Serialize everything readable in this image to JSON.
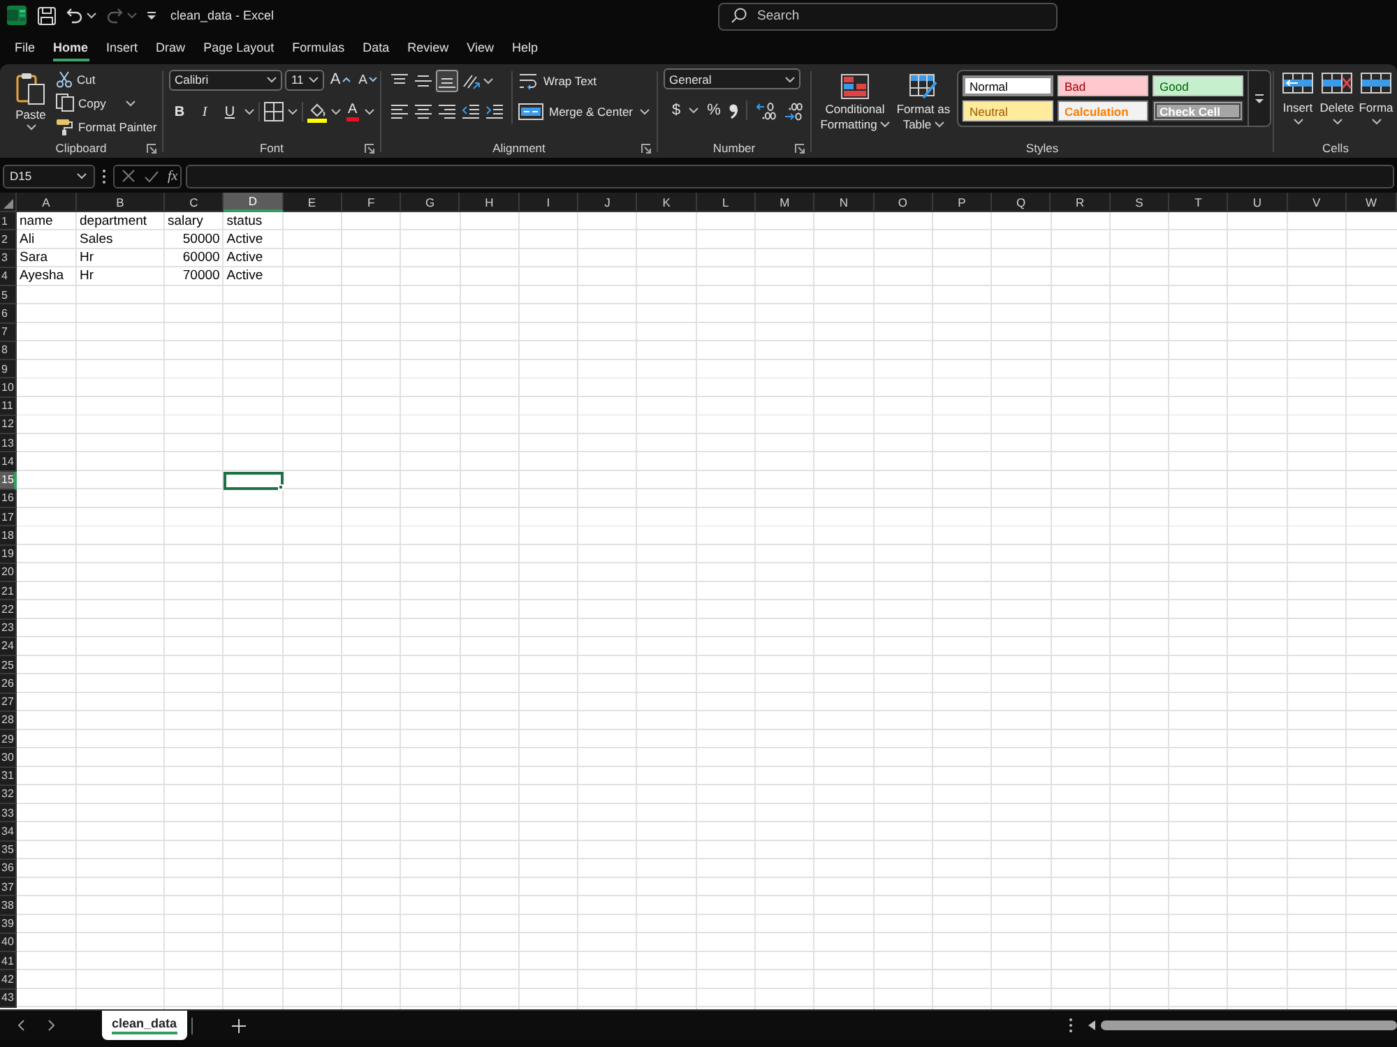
{
  "title_bar": {
    "quick_access": [
      {
        "kind": "save",
        "disabled": false
      },
      {
        "kind": "undo",
        "disabled": false
      },
      {
        "kind": "redo",
        "disabled": true
      }
    ],
    "title": "clean_data - Excel",
    "search": {
      "placeholder": "Search"
    }
  },
  "ribbon_tabs": [
    {
      "label": "File",
      "selected": false
    },
    {
      "label": "Home",
      "selected": true
    },
    {
      "label": "Insert",
      "selected": false
    },
    {
      "label": "Draw",
      "selected": false
    },
    {
      "label": "Page Layout",
      "selected": false
    },
    {
      "label": "Formulas",
      "selected": false
    },
    {
      "label": "Data",
      "selected": false
    },
    {
      "label": "Review",
      "selected": false
    },
    {
      "label": "View",
      "selected": false
    },
    {
      "label": "Help",
      "selected": false
    }
  ],
  "ribbon": {
    "clipboard": {
      "label": "Clipboard",
      "paste": "Paste",
      "cut": "Cut",
      "copy": "Copy",
      "format_painter": "Format Painter"
    },
    "font": {
      "label": "Font",
      "font_name": "Calibri",
      "font_size": "11",
      "grow": "A",
      "shrink": "A",
      "styles": [
        {
          "kind": "bold",
          "label": "B",
          "selected": false
        },
        {
          "kind": "italic",
          "label": "I",
          "selected": false
        },
        {
          "kind": "underline",
          "label": "U",
          "selected": false
        }
      ],
      "font_color": "A"
    },
    "alignment": {
      "label": "Alignment",
      "vertical": [
        {
          "kind": "top",
          "selected": false
        },
        {
          "kind": "middle",
          "selected": false
        },
        {
          "kind": "bottom",
          "selected": true
        }
      ],
      "horizontal": [
        {
          "kind": "left",
          "selected": false
        },
        {
          "kind": "center",
          "selected": false
        },
        {
          "kind": "right",
          "selected": false
        }
      ],
      "wrap_text": "Wrap Text",
      "merge_center": "Merge & Center"
    },
    "number": {
      "label": "Number",
      "format": "General",
      "currency": "$",
      "percent": "%"
    },
    "styles": {
      "label": "Styles",
      "conditional_formatting": "Conditional Formatting",
      "format_as_table": "Format as Table",
      "gallery": [
        {
          "kind": "normal",
          "label": "Normal",
          "selected": true
        },
        {
          "kind": "bad",
          "label": "Bad",
          "selected": false
        },
        {
          "kind": "good",
          "label": "Good",
          "selected": false
        },
        {
          "kind": "neutral",
          "label": "Neutral",
          "selected": false
        },
        {
          "kind": "calculation",
          "label": "Calculation",
          "selected": false
        },
        {
          "kind": "check",
          "label": "Check Cell",
          "selected": false
        }
      ]
    },
    "cells": {
      "label": "Cells",
      "buttons": [
        {
          "kind": "insert",
          "label": "Insert"
        },
        {
          "kind": "delete",
          "label": "Delete"
        },
        {
          "kind": "format",
          "label": "Forma"
        }
      ]
    }
  },
  "formula_bar": {
    "name_box": "D15",
    "function_label": "fx"
  },
  "sheet": {
    "columns": [
      {
        "label": "A",
        "selected": false
      },
      {
        "label": "B",
        "selected": false
      },
      {
        "label": "C",
        "selected": false
      },
      {
        "label": "D",
        "selected": true
      },
      {
        "label": "E",
        "selected": false
      },
      {
        "label": "F",
        "selected": false
      },
      {
        "label": "G",
        "selected": false
      },
      {
        "label": "H",
        "selected": false
      },
      {
        "label": "I",
        "selected": false
      },
      {
        "label": "J",
        "selected": false
      },
      {
        "label": "K",
        "selected": false
      },
      {
        "label": "L",
        "selected": false
      },
      {
        "label": "M",
        "selected": false
      },
      {
        "label": "N",
        "selected": false
      },
      {
        "label": "O",
        "selected": false
      },
      {
        "label": "P",
        "selected": false
      },
      {
        "label": "Q",
        "selected": false
      },
      {
        "label": "R",
        "selected": false
      },
      {
        "label": "S",
        "selected": false
      },
      {
        "label": "T",
        "selected": false
      },
      {
        "label": "U",
        "selected": false
      },
      {
        "label": "V",
        "selected": false
      },
      {
        "label": "W",
        "selected": false
      }
    ],
    "rows": [
      {
        "number": "1",
        "selected": false,
        "cells": [
          {
            "value": "name",
            "kind": "text"
          },
          {
            "value": "department",
            "kind": "text"
          },
          {
            "value": "salary",
            "kind": "text"
          },
          {
            "value": "status",
            "kind": "text"
          }
        ]
      },
      {
        "number": "2",
        "selected": false,
        "cells": [
          {
            "value": "Ali",
            "kind": "text"
          },
          {
            "value": "Sales",
            "kind": "text"
          },
          {
            "value": "50000",
            "kind": "number"
          },
          {
            "value": "Active",
            "kind": "text"
          }
        ]
      },
      {
        "number": "3",
        "selected": false,
        "cells": [
          {
            "value": "Sara",
            "kind": "text"
          },
          {
            "value": "Hr",
            "kind": "text"
          },
          {
            "value": "60000",
            "kind": "number"
          },
          {
            "value": "Active",
            "kind": "text"
          }
        ]
      },
      {
        "number": "4",
        "selected": false,
        "cells": [
          {
            "value": "Ayesha",
            "kind": "text"
          },
          {
            "value": "Hr",
            "kind": "text"
          },
          {
            "value": "70000",
            "kind": "number"
          },
          {
            "value": "Active",
            "kind": "text"
          }
        ]
      },
      {
        "number": "5",
        "selected": false
      },
      {
        "number": "6",
        "selected": false
      },
      {
        "number": "7",
        "selected": false
      },
      {
        "number": "8",
        "selected": false
      },
      {
        "number": "9",
        "selected": false
      },
      {
        "number": "10",
        "selected": false
      },
      {
        "number": "11",
        "selected": false
      },
      {
        "number": "12",
        "selected": false
      },
      {
        "number": "13",
        "selected": false
      },
      {
        "number": "14",
        "selected": false
      },
      {
        "number": "15",
        "selected": true
      },
      {
        "number": "16",
        "selected": false
      },
      {
        "number": "17",
        "selected": false
      },
      {
        "number": "18",
        "selected": false
      },
      {
        "number": "19",
        "selected": false
      },
      {
        "number": "20",
        "selected": false
      },
      {
        "number": "21",
        "selected": false
      },
      {
        "number": "22",
        "selected": false
      },
      {
        "number": "23",
        "selected": false
      },
      {
        "number": "24",
        "selected": false
      },
      {
        "number": "25",
        "selected": false
      },
      {
        "number": "26",
        "selected": false
      },
      {
        "number": "27",
        "selected": false
      },
      {
        "number": "28",
        "selected": false
      },
      {
        "number": "29",
        "selected": false
      },
      {
        "number": "30",
        "selected": false
      },
      {
        "number": "31",
        "selected": false
      },
      {
        "number": "32",
        "selected": false
      },
      {
        "number": "33",
        "selected": false
      },
      {
        "number": "34",
        "selected": false
      },
      {
        "number": "35",
        "selected": false
      },
      {
        "number": "36",
        "selected": false
      },
      {
        "number": "37",
        "selected": false
      },
      {
        "number": "38",
        "selected": false
      },
      {
        "number": "39",
        "selected": false
      },
      {
        "number": "40",
        "selected": false
      },
      {
        "number": "41",
        "selected": false
      },
      {
        "number": "42",
        "selected": false
      },
      {
        "number": "43",
        "selected": false
      }
    ]
  },
  "sheet_tabs": [
    {
      "label": "clean_data",
      "selected": true
    }
  ]
}
